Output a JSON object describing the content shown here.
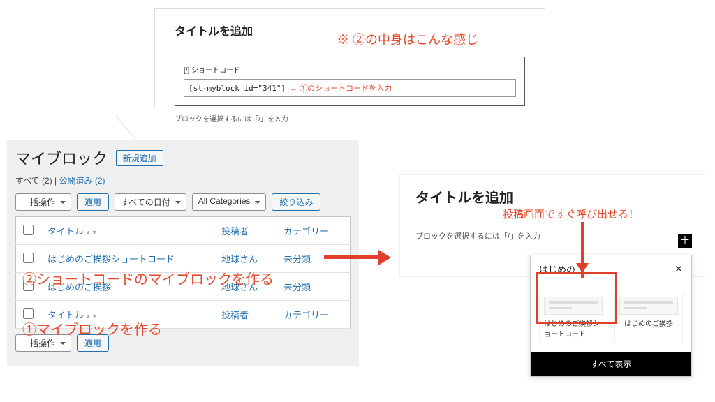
{
  "callout": {
    "title_add": "タイトルを追加",
    "red_note": "※ ②の中身はこんな感じ",
    "shortcode_label": "[/] ショートコード",
    "shortcode_value": "[st-myblock id=\"341\"]",
    "shortcode_hint": "← ①のショートコードを入力",
    "block_hint": "ブロックを選択するには「/」を入力"
  },
  "admin": {
    "heading": "マイブロック",
    "add_new": "新規追加",
    "filters": {
      "all": "すべて (2)",
      "sep": " | ",
      "published": "公開済み (2)"
    },
    "bulk_action": "一括操作",
    "apply": "適用",
    "all_dates": "すべての日付",
    "all_categories": "All Categories",
    "filter": "絞り込み",
    "columns": {
      "title": "タイトル",
      "author": "投稿者",
      "category": "カテゴリー"
    },
    "rows": [
      {
        "title": "はじめのご挨拶ショートコード",
        "author": "地球さん",
        "category": "未分類"
      },
      {
        "title": "はじめのご挨拶",
        "author": "地球さん",
        "category": "未分類"
      }
    ]
  },
  "overlay": {
    "step2": "②ショートコードのマイブロックを作る",
    "step1": "①マイブロックを作る"
  },
  "editor": {
    "title_add": "タイトルを追加",
    "red_label": "投稿画面ですぐ呼び出せる！",
    "hint": "ブロックを選択するには「/」を入力",
    "search_value": "はじめの",
    "results": [
      "はじめのご挨拶ショートコード",
      "はじめのご挨拶"
    ],
    "show_all": "すべて表示"
  }
}
